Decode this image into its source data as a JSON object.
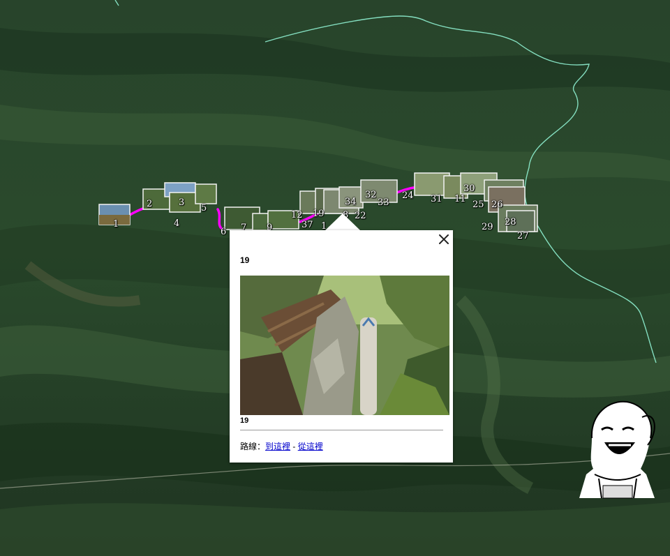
{
  "map": {
    "colors": {
      "trail": "#ff00ff",
      "boundary": "#8ef0d0",
      "terrain_dark": "#1f3a22",
      "terrain_light": "#3d5f38"
    },
    "markers": [
      {
        "id": "m1",
        "label": "1"
      },
      {
        "id": "m2",
        "label": "2"
      },
      {
        "id": "m3",
        "label": "3"
      },
      {
        "id": "m4",
        "label": "4"
      },
      {
        "id": "m5",
        "label": "5"
      },
      {
        "id": "m6",
        "label": "6"
      },
      {
        "id": "m7",
        "label": "7"
      },
      {
        "id": "m9",
        "label": "9"
      },
      {
        "id": "m12",
        "label": "12"
      },
      {
        "id": "m19",
        "label": "19"
      },
      {
        "id": "m37",
        "label": "37"
      },
      {
        "id": "m1x",
        "label": "1"
      },
      {
        "id": "m18",
        "label": "8"
      },
      {
        "id": "m22",
        "label": "22"
      },
      {
        "id": "m34",
        "label": "34"
      },
      {
        "id": "m32",
        "label": "32"
      },
      {
        "id": "m33",
        "label": "33"
      },
      {
        "id": "m24",
        "label": "24"
      },
      {
        "id": "m31",
        "label": "31"
      },
      {
        "id": "m11",
        "label": "11"
      },
      {
        "id": "m30",
        "label": "30"
      },
      {
        "id": "m25",
        "label": "25"
      },
      {
        "id": "m26",
        "label": "26"
      },
      {
        "id": "m29",
        "label": "29"
      },
      {
        "id": "m28",
        "label": "28"
      },
      {
        "id": "m27",
        "label": "27"
      }
    ]
  },
  "popup": {
    "title": "19",
    "caption": "19",
    "photo_icon": "trail-summit-photo",
    "route_label": "路線：",
    "to_here": "到這裡",
    "separator": " - ",
    "from_here": "從這裡",
    "close_icon": "close-icon"
  },
  "logo": {
    "icon": "girl-face-logo"
  }
}
